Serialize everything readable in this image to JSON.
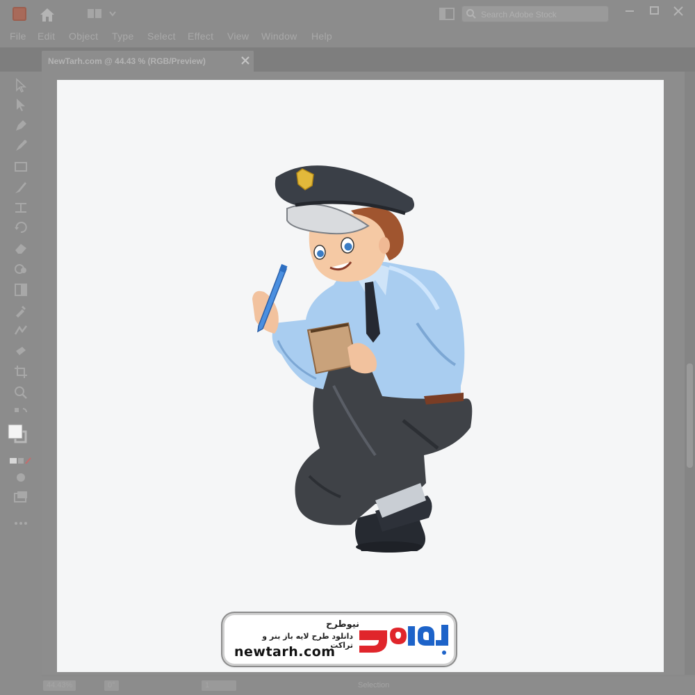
{
  "app": {
    "search_placeholder": "Search Adobe Stock",
    "icons": [
      "illustrator-logo-icon",
      "home-icon",
      "workspace-switcher-icon",
      "arrange-documents-icon",
      "search-icon",
      "minimize-icon",
      "restore-icon",
      "close-icon"
    ]
  },
  "menu": {
    "items": [
      "File",
      "Edit",
      "Object",
      "Type",
      "Select",
      "Effect",
      "View",
      "Window",
      "Help"
    ]
  },
  "document": {
    "tab_title": "NewTarh.com @ 44.43 % (RGB/Preview)",
    "tab_close": "×"
  },
  "toolbar": {
    "tools": [
      "selection-tool",
      "direct-selection-tool",
      "pen-tool",
      "curvature-tool",
      "rectangle-tool",
      "paintbrush-tool",
      "width-tool",
      "rotate-tool",
      "eraser-tool",
      "shape-builder-tool",
      "gradient-tool",
      "eyedropper-tool",
      "blend-tool",
      "symbol-sprayer-tool",
      "artboard-tool",
      "zoom-tool",
      "swap-colors-tool",
      "fill-stroke-swatch",
      "color-mode-buttons",
      "draw-mode-button",
      "screen-mode-button",
      "more-tools-button"
    ]
  },
  "status": {
    "zoom": "44.43%",
    "rotation": "0°",
    "artboard": "1",
    "tool": "Selection"
  },
  "watermark": {
    "persian_title": "نیوطرح",
    "persian_subtitle": "دانلود طرح لایه باز بنر و تراکت",
    "domain": "newtarh.com",
    "logo_text": "نیوطرح",
    "logo_colors": {
      "red": "#e0252b",
      "blue": "#1d63c9"
    }
  },
  "colors": {
    "shirt": "#a9cdf0",
    "pants": "#3f4247",
    "cap": "#3a3f47",
    "artboard": "#f5f6f7"
  }
}
